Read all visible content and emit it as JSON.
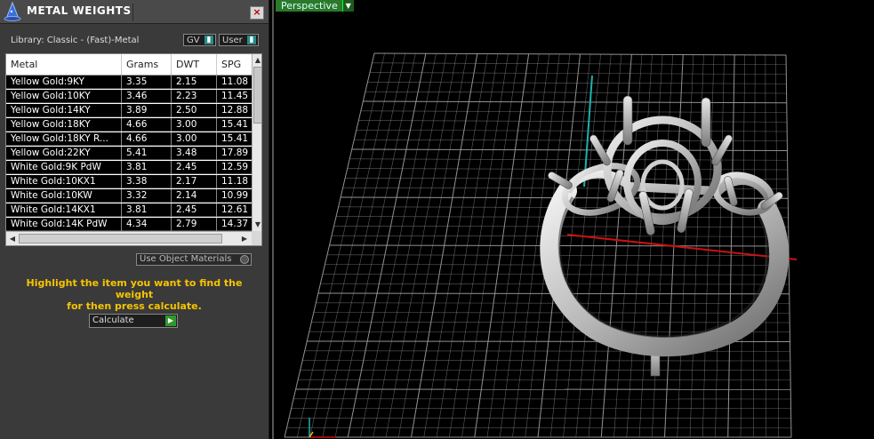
{
  "panel": {
    "title": "METAL WEIGHTS",
    "close_glyph": "×",
    "library_label": "Library: Classic - (Fast)-Metal",
    "gv_label": "GV",
    "user_label": "User",
    "table": {
      "columns": [
        "Metal",
        "Grams",
        "DWT",
        "SPG"
      ],
      "rows": [
        [
          "Yellow Gold:9KY",
          "3.35",
          "2.15",
          "11.08"
        ],
        [
          "Yellow Gold:10KY",
          "3.46",
          "2.23",
          "11.45"
        ],
        [
          "Yellow Gold:14KY",
          "3.89",
          "2.50",
          "12.88"
        ],
        [
          "Yellow Gold:18KY",
          "4.66",
          "3.00",
          "15.41"
        ],
        [
          "Yellow Gold:18KY R...",
          "4.66",
          "3.00",
          "15.41"
        ],
        [
          "Yellow Gold:22KY",
          "5.41",
          "3.48",
          "17.89"
        ],
        [
          "White Gold:9K PdW",
          "3.81",
          "2.45",
          "12.59"
        ],
        [
          "White Gold:10KX1",
          "3.38",
          "2.17",
          "11.18"
        ],
        [
          "White Gold:10KW",
          "3.32",
          "2.14",
          "10.99"
        ],
        [
          "White Gold:14KX1",
          "3.81",
          "2.45",
          "12.61"
        ],
        [
          "White Gold:14K PdW",
          "4.34",
          "2.79",
          "14.37"
        ]
      ]
    },
    "use_object_materials_label": "Use Object Materials",
    "hint_line1": "Highlight the item you want to find the weight",
    "hint_line2": "for then press calculate.",
    "calculate_label": "Calculate"
  },
  "viewport": {
    "view_label": "Perspective",
    "grid_color": "#9a9a9a",
    "axis_x_color": "#cc1111",
    "axis_y_color": "#1fb0b0",
    "model": "ring-with-three-stone-prong-settings"
  },
  "icons": {
    "logo": "wizard-hat-logo-icon",
    "close": "close-icon",
    "dropdown": "dropdown-arrow-icon",
    "play": "play-icon"
  }
}
